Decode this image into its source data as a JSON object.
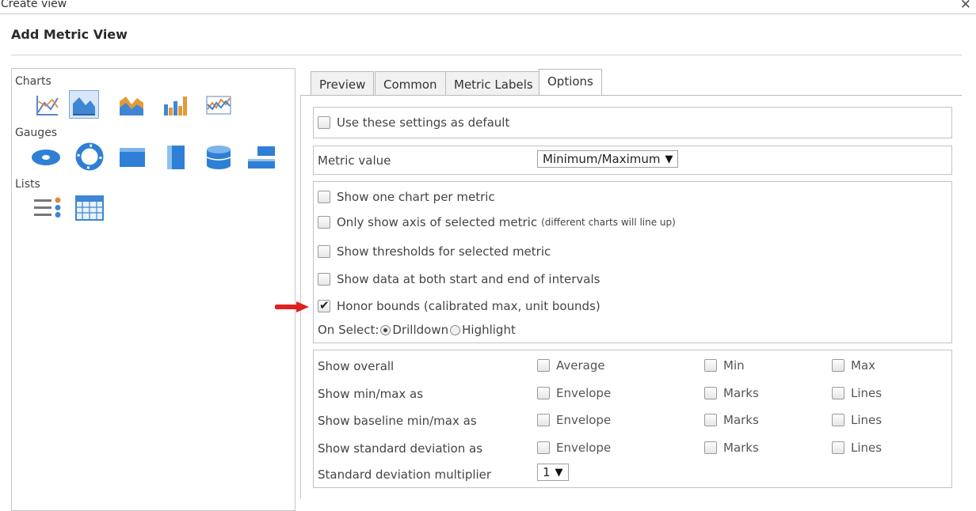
{
  "window": {
    "title": "Create view",
    "close_icon": "close-icon"
  },
  "dialog": {
    "heading": "Add Metric View"
  },
  "left_panel": {
    "sections": [
      {
        "label": "Charts",
        "icons": [
          "line-chart-icon",
          "area-chart-icon",
          "stacked-area-chart-icon",
          "bar-chart-icon",
          "multi-line-chart-icon"
        ],
        "selected": "area-chart-icon"
      },
      {
        "label": "Gauges",
        "icons": [
          "oval-gauge-icon",
          "ring-gauge-icon",
          "horizontal-gauge-icon",
          "vertical-gauge-icon",
          "cylinder-gauge-icon",
          "horizontal-bar-gauge-icon"
        ]
      },
      {
        "label": "Lists",
        "icons": [
          "list-icon",
          "table-icon"
        ]
      }
    ]
  },
  "tabs": [
    "Preview",
    "Common",
    "Metric Labels",
    "Options"
  ],
  "active_tab": "Options",
  "options": {
    "use_default": {
      "label": "Use these settings as default",
      "checked": false
    },
    "metric_value": {
      "label": "Metric value",
      "value": "Minimum/Maximum"
    },
    "checks": [
      {
        "label": "Show one chart per metric",
        "checked": false,
        "note": ""
      },
      {
        "label": "Only show axis of selected metric",
        "checked": false,
        "note": "(different charts will line up)"
      },
      {
        "label": "Show thresholds for selected metric",
        "checked": false,
        "note": ""
      },
      {
        "label": "Show data at both start and end of intervals",
        "checked": false,
        "note": ""
      },
      {
        "label": "Honor bounds (calibrated max, unit bounds)",
        "checked": true,
        "note": ""
      }
    ],
    "on_select": {
      "label": "On Select:",
      "options": [
        "Drilldown",
        "Highlight"
      ],
      "selected": "Drilldown"
    },
    "grid": [
      {
        "label": "Show overall",
        "options": [
          "Average",
          "Min",
          "Max"
        ]
      },
      {
        "label": "Show min/max as",
        "options": [
          "Envelope",
          "Marks",
          "Lines"
        ]
      },
      {
        "label": "Show baseline min/max as",
        "options": [
          "Envelope",
          "Marks",
          "Lines"
        ]
      },
      {
        "label": "Show standard deviation as",
        "options": [
          "Envelope",
          "Marks",
          "Lines"
        ]
      }
    ],
    "std_multiplier": {
      "label": "Standard deviation multiplier",
      "value": "1"
    }
  },
  "annotation": {
    "arrow_color": "#e02020"
  }
}
